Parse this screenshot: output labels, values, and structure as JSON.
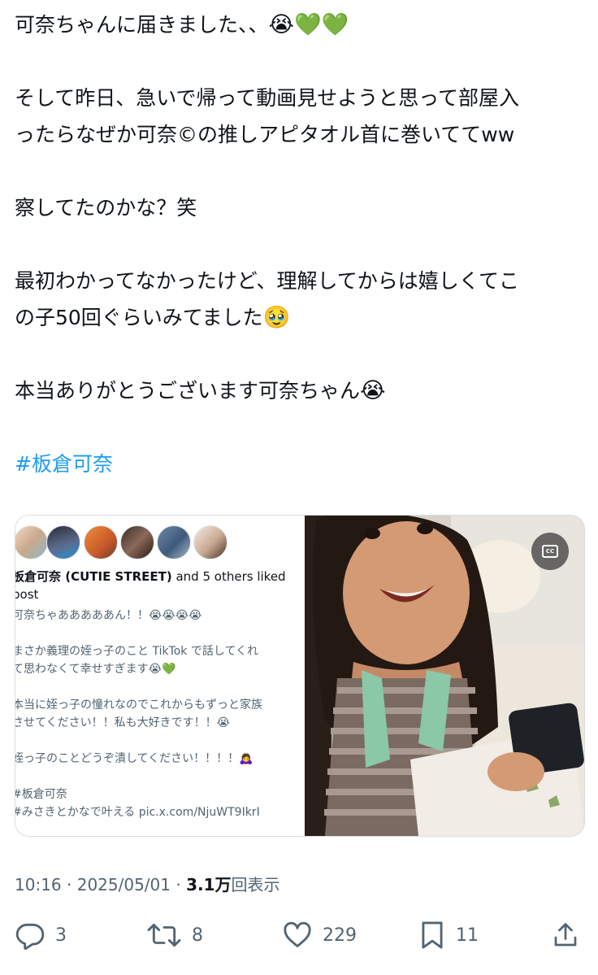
{
  "tweet": {
    "lines": [
      "可奈ちゃんに届きました、、",
      "",
      "そして昨日、急いで帰って動画見せようと思って部屋入",
      "ったらなぜか可奈©の推しアピタオル首に巻いててww",
      "",
      "察してたのかな？笑",
      "",
      "最初わかってなかったけど、理解してからは嬉しくてこ",
      "の子50回ぐらいみてました",
      "",
      "本当ありがとうございます可奈ちゃん"
    ],
    "emoji_line1": "😭💚💚",
    "emoji_line9": "🥹",
    "emoji_line11": "😭",
    "hashtag": "#板倉可奈"
  },
  "card": {
    "liked_name": "板倉可奈 (CUTIE STREET)",
    "liked_rest": " and 5 others liked",
    "liked_line2": "post",
    "quote_lines": [
      "可奈ちゃあああああん！！😭😭😭😭",
      "",
      "まさか義理の姪っ子のこと TikTok で話してくれ",
      "て思わなくて幸せすぎます😭💚",
      "",
      "本当に姪っ子の憧れなのでこれからもずっと家族",
      "させてください！！私も大好きです！！😭",
      "",
      "姪っ子のことどうぞ潰してください！！！！🙇‍♀️",
      "",
      "#板倉可奈",
      "#みさきとかなで叶える pic.x.com/NjuWT9IkrI"
    ],
    "cc_label": "CC"
  },
  "meta": {
    "time": "10:16",
    "sep1": " · ",
    "date": "2025/05/01",
    "sep2": " · ",
    "views": "3.1万",
    "views_label": "回表示"
  },
  "actions": {
    "replies": "3",
    "reposts": "8",
    "likes": "229",
    "bookmarks": "11"
  },
  "colors": {
    "link": "#1d9bf0",
    "secondary": "#536471",
    "text": "#0f1419"
  },
  "icons": [
    "reply-icon",
    "repost-icon",
    "like-icon",
    "bookmark-icon",
    "share-icon",
    "cc-icon"
  ]
}
